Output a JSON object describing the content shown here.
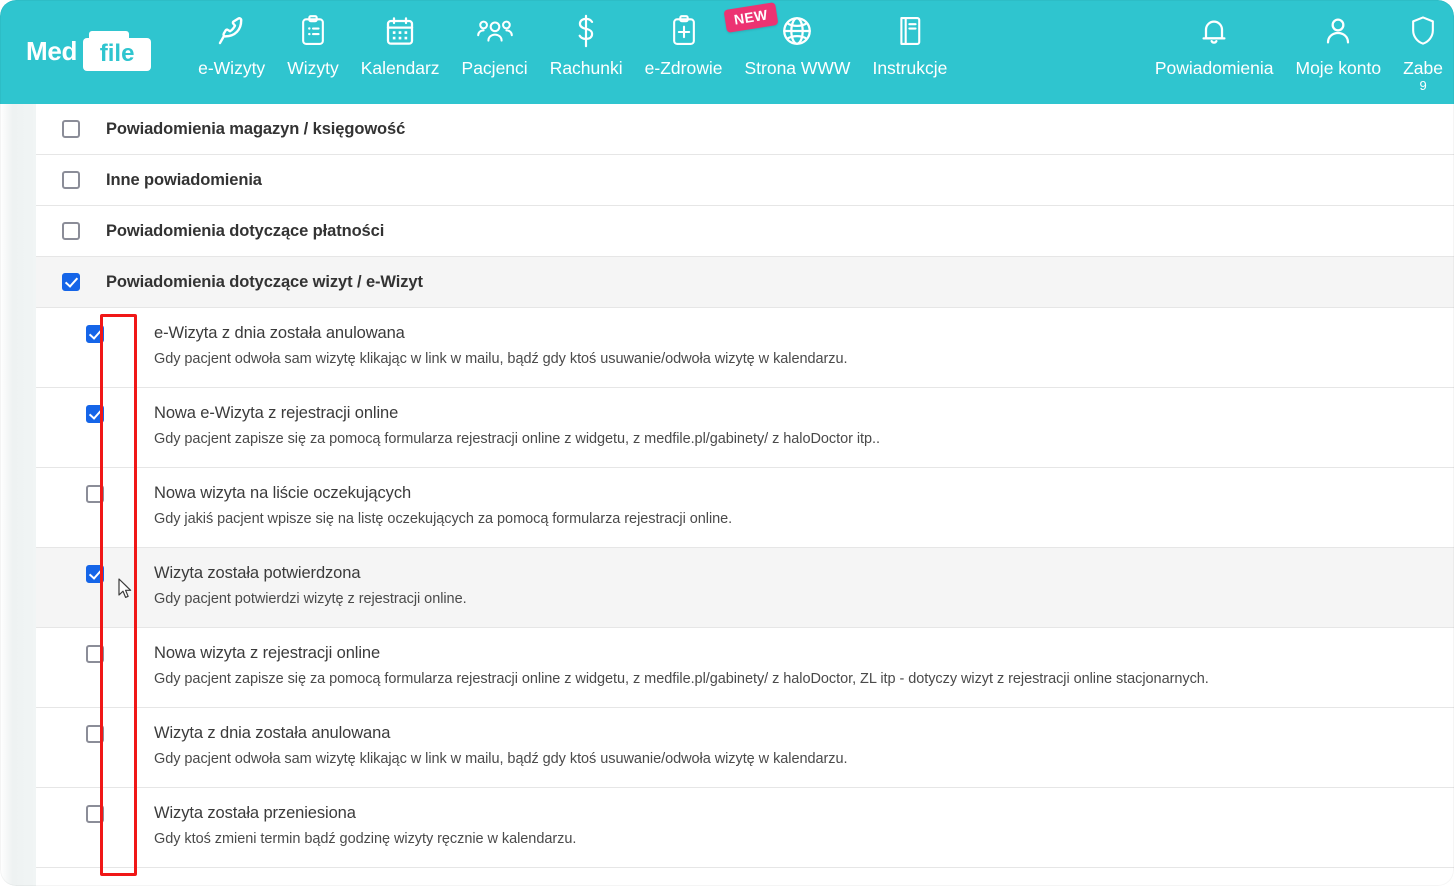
{
  "brand": {
    "name_part1": "Med",
    "name_part2": "file",
    "teal": "#2FC5CF",
    "pink": "#EC3372",
    "checkbox_blue": "#1565E8",
    "highlight_red": "#f01717"
  },
  "topnav": {
    "items": [
      {
        "label": "e-Wizyty",
        "icon": "phone-icon"
      },
      {
        "label": "Wizyty",
        "icon": "clipboard-list-icon"
      },
      {
        "label": "Kalendarz",
        "icon": "calendar-icon"
      },
      {
        "label": "Pacjenci",
        "icon": "people-group-icon"
      },
      {
        "label": "Rachunki",
        "icon": "dollar-icon"
      },
      {
        "label": "e-Zdrowie",
        "icon": "clipboard-plus-icon"
      },
      {
        "label": "Strona WWW",
        "icon": "globe-icon",
        "badge": "NEW"
      },
      {
        "label": "Instrukcje",
        "icon": "book-icon"
      }
    ],
    "right_items": [
      {
        "label": "Powiadomienia",
        "icon": "bell-icon"
      },
      {
        "label": "Moje konto",
        "icon": "user-icon"
      },
      {
        "label": "Zabe",
        "sublabel": "9",
        "icon": "shield-icon",
        "clipped": true
      }
    ]
  },
  "categories": [
    {
      "label": "Powiadomienia magazyn / księgowość",
      "checked": false,
      "shaded": false
    },
    {
      "label": "Inne powiadomienia",
      "checked": false,
      "shaded": false
    },
    {
      "label": "Powiadomienia dotyczące płatności",
      "checked": false,
      "shaded": false
    },
    {
      "label": "Powiadomienia dotyczące wizyt / e-Wizyt",
      "checked": true,
      "shaded": true
    }
  ],
  "subitems": [
    {
      "title": "e-Wizyta z dnia została anulowana",
      "desc": "Gdy pacjent odwoła sam wizytę klikając w link w mailu, bądź gdy ktoś usuwanie/odwoła wizytę w kalendarzu.",
      "checked": true,
      "shaded": false
    },
    {
      "title": "Nowa e-Wizyta z rejestracji online",
      "desc": "Gdy pacjent zapisze się za pomocą formularza rejestracji online z widgetu, z medfile.pl/gabinety/ z haloDoctor itp..",
      "checked": true,
      "shaded": false
    },
    {
      "title": "Nowa wizyta na liście oczekujących",
      "desc": "Gdy jakiś pacjent wpisze się na listę oczekujących za pomocą formularza rejestracji online.",
      "checked": false,
      "shaded": false
    },
    {
      "title": "Wizyta została potwierdzona",
      "desc": "Gdy pacjent potwierdzi wizytę z rejestracji online.",
      "checked": true,
      "shaded": true
    },
    {
      "title": "Nowa wizyta z rejestracji online",
      "desc": "Gdy pacjent zapisze się za pomocą formularza rejestracji online z widgetu, z medfile.pl/gabinety/ z haloDoctor, ZL itp - dotyczy wizyt z rejestracji online stacjonarnych.",
      "checked": false,
      "shaded": false
    },
    {
      "title": "Wizyta z dnia została anulowana",
      "desc": "Gdy pacjent odwoła sam wizytę klikając w link w mailu, bądź gdy ktoś usuwanie/odwoła wizytę w kalendarzu.",
      "checked": false,
      "shaded": false
    },
    {
      "title": "Wizyta została przeniesiona",
      "desc": "Gdy ktoś zmieni termin bądź godzinę wizyty ręcznie w kalendarzu.",
      "checked": false,
      "shaded": false
    }
  ]
}
